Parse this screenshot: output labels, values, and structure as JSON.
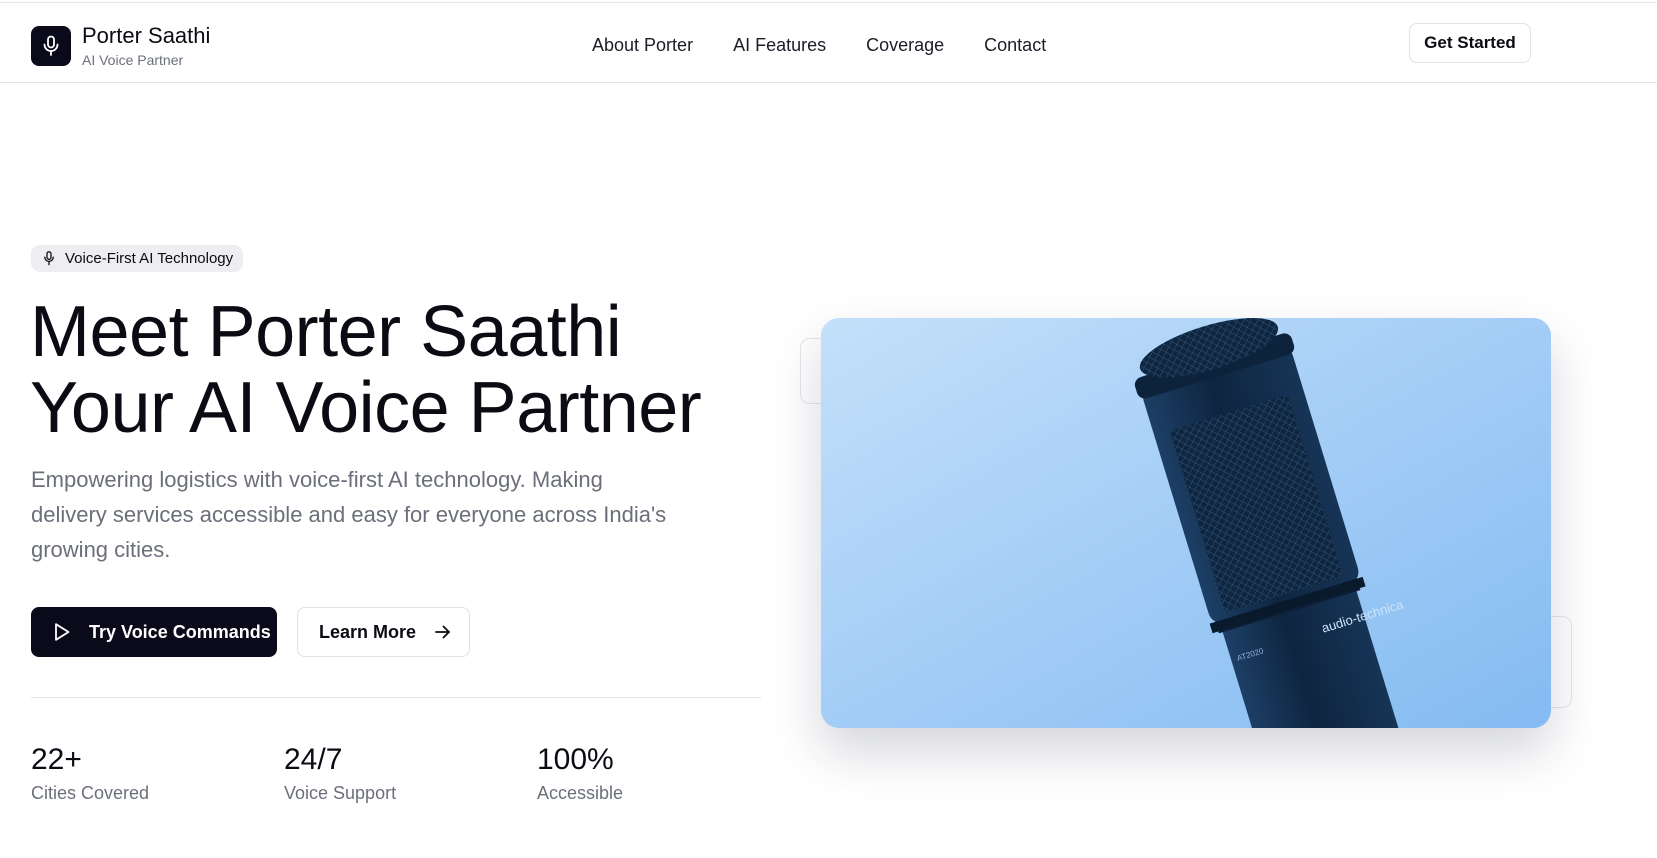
{
  "header": {
    "brand_name": "Porter Saathi",
    "brand_tagline": "AI Voice Partner",
    "brand_icon": "microphone-icon",
    "nav": [
      {
        "label": "About Porter"
      },
      {
        "label": "AI Features"
      },
      {
        "label": "Coverage"
      },
      {
        "label": "Contact"
      }
    ],
    "cta_label": "Get Started"
  },
  "hero": {
    "badge_icon": "microphone-icon",
    "badge_label": "Voice-First AI Technology",
    "title_line1": "Meet Porter Saathi",
    "title_line2": "Your AI Voice Partner",
    "description": "Empowering logistics with voice-first AI technology. Making delivery services accessible and easy for everyone across India's growing cities.",
    "primary_button": {
      "label": "Try Voice Commands",
      "icon": "play-icon"
    },
    "secondary_button": {
      "label": "Learn More",
      "icon": "arrow-right-icon"
    },
    "image_brand_text": "audio-technica",
    "image_model_text": "AT2020"
  },
  "stats": [
    {
      "value": "22+",
      "label": "Cities Covered"
    },
    {
      "value": "24/7",
      "label": "Voice Support"
    },
    {
      "value": "100%",
      "label": "Accessible"
    }
  ],
  "colors": {
    "primary": "#0a0a1a",
    "muted_text": "#6b6f7a",
    "image_tint": "#8cc2f4"
  }
}
